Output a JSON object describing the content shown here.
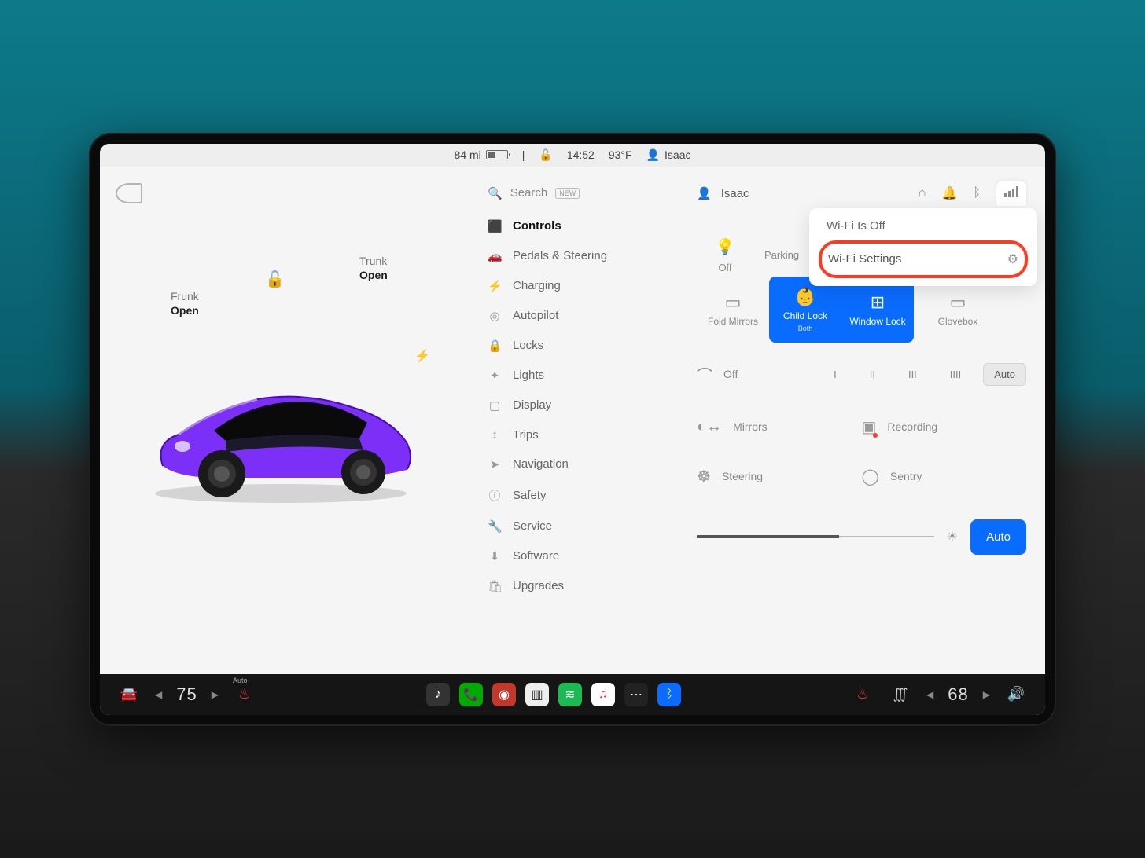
{
  "statusbar": {
    "range": "84 mi",
    "time": "14:52",
    "temperature": "93°F",
    "profile": "Isaac"
  },
  "left": {
    "frunk_label": "Frunk",
    "frunk_state": "Open",
    "trunk_label": "Trunk",
    "trunk_state": "Open"
  },
  "menu": {
    "search_label": "Search",
    "search_badge": "NEW",
    "items": [
      {
        "icon": "⬛",
        "label": "Controls",
        "active": true
      },
      {
        "icon": "🚗",
        "label": "Pedals & Steering"
      },
      {
        "icon": "⚡",
        "label": "Charging"
      },
      {
        "icon": "◎",
        "label": "Autopilot"
      },
      {
        "icon": "🔒",
        "label": "Locks"
      },
      {
        "icon": "✦",
        "label": "Lights"
      },
      {
        "icon": "▢",
        "label": "Display"
      },
      {
        "icon": "↕",
        "label": "Trips"
      },
      {
        "icon": "➤",
        "label": "Navigation"
      },
      {
        "icon": "ⓘ",
        "label": "Safety"
      },
      {
        "icon": "🔧",
        "label": "Service"
      },
      {
        "icon": "⬇",
        "label": "Software"
      },
      {
        "icon": "🛍",
        "label": "Upgrades"
      }
    ]
  },
  "right": {
    "profile": "Isaac",
    "quick_lights_label": "Off",
    "quick_parking_label": "Parking",
    "fold_mirrors": "Fold Mirrors",
    "child_lock": "Child Lock",
    "child_lock_sub": "Both",
    "window_lock": "Window Lock",
    "glovebox": "Glovebox",
    "wiper_off": "Off",
    "wiper_levels": [
      "I",
      "II",
      "III",
      "IIII"
    ],
    "wiper_auto": "Auto",
    "mirrors": "Mirrors",
    "recording": "Recording",
    "steering": "Steering",
    "sentry": "Sentry",
    "brightness_auto": "Auto"
  },
  "wifi": {
    "status": "Wi-Fi Is Off",
    "settings": "Wi-Fi Settings"
  },
  "dock": {
    "left_temp": "75",
    "right_temp": "68",
    "seat_auto": "Auto"
  }
}
